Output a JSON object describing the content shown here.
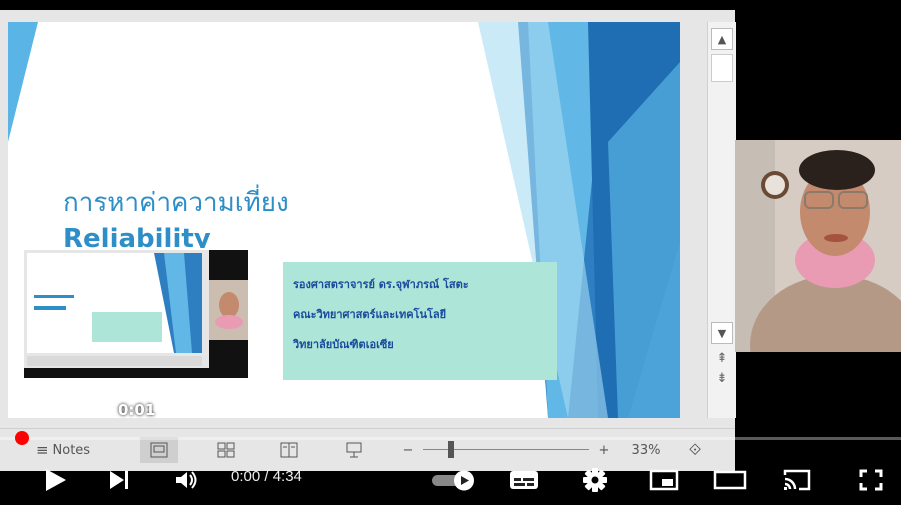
{
  "slide": {
    "title_th": "การหาค่าความเที่ยง",
    "title_en": "Reliability",
    "author_lines": [
      "รองศาสตราจารย์ ดร.จุฬาภรณ์  โสตะ",
      "คณะวิทยาศาสตร์และเทคโนโลยี",
      "วิทยาลัยบัณฑิตเอเซีย"
    ]
  },
  "viewer": {
    "notes_label": "Notes",
    "zoom_minus": "−",
    "zoom_plus": "+",
    "zoom_level": "33%",
    "zoom_fraction": 0.33
  },
  "player": {
    "hover_time": "0:01",
    "time_display": "0:00 / 4:34",
    "progress_fraction": 0.0
  },
  "colors": {
    "accent": "#2e8ec7",
    "author_box": "#ade5d8",
    "progress": "#ff0000"
  },
  "icons": [
    "notes-icon",
    "normal-view-icon",
    "slide-sorter-icon",
    "reading-view-icon",
    "slideshow-icon",
    "zoom-fit-icon",
    "play-icon",
    "next-icon",
    "volume-icon",
    "autoplay-toggle-icon",
    "subtitles-icon",
    "settings-icon",
    "miniplayer-icon",
    "theater-icon",
    "cast-icon",
    "fullscreen-icon"
  ]
}
